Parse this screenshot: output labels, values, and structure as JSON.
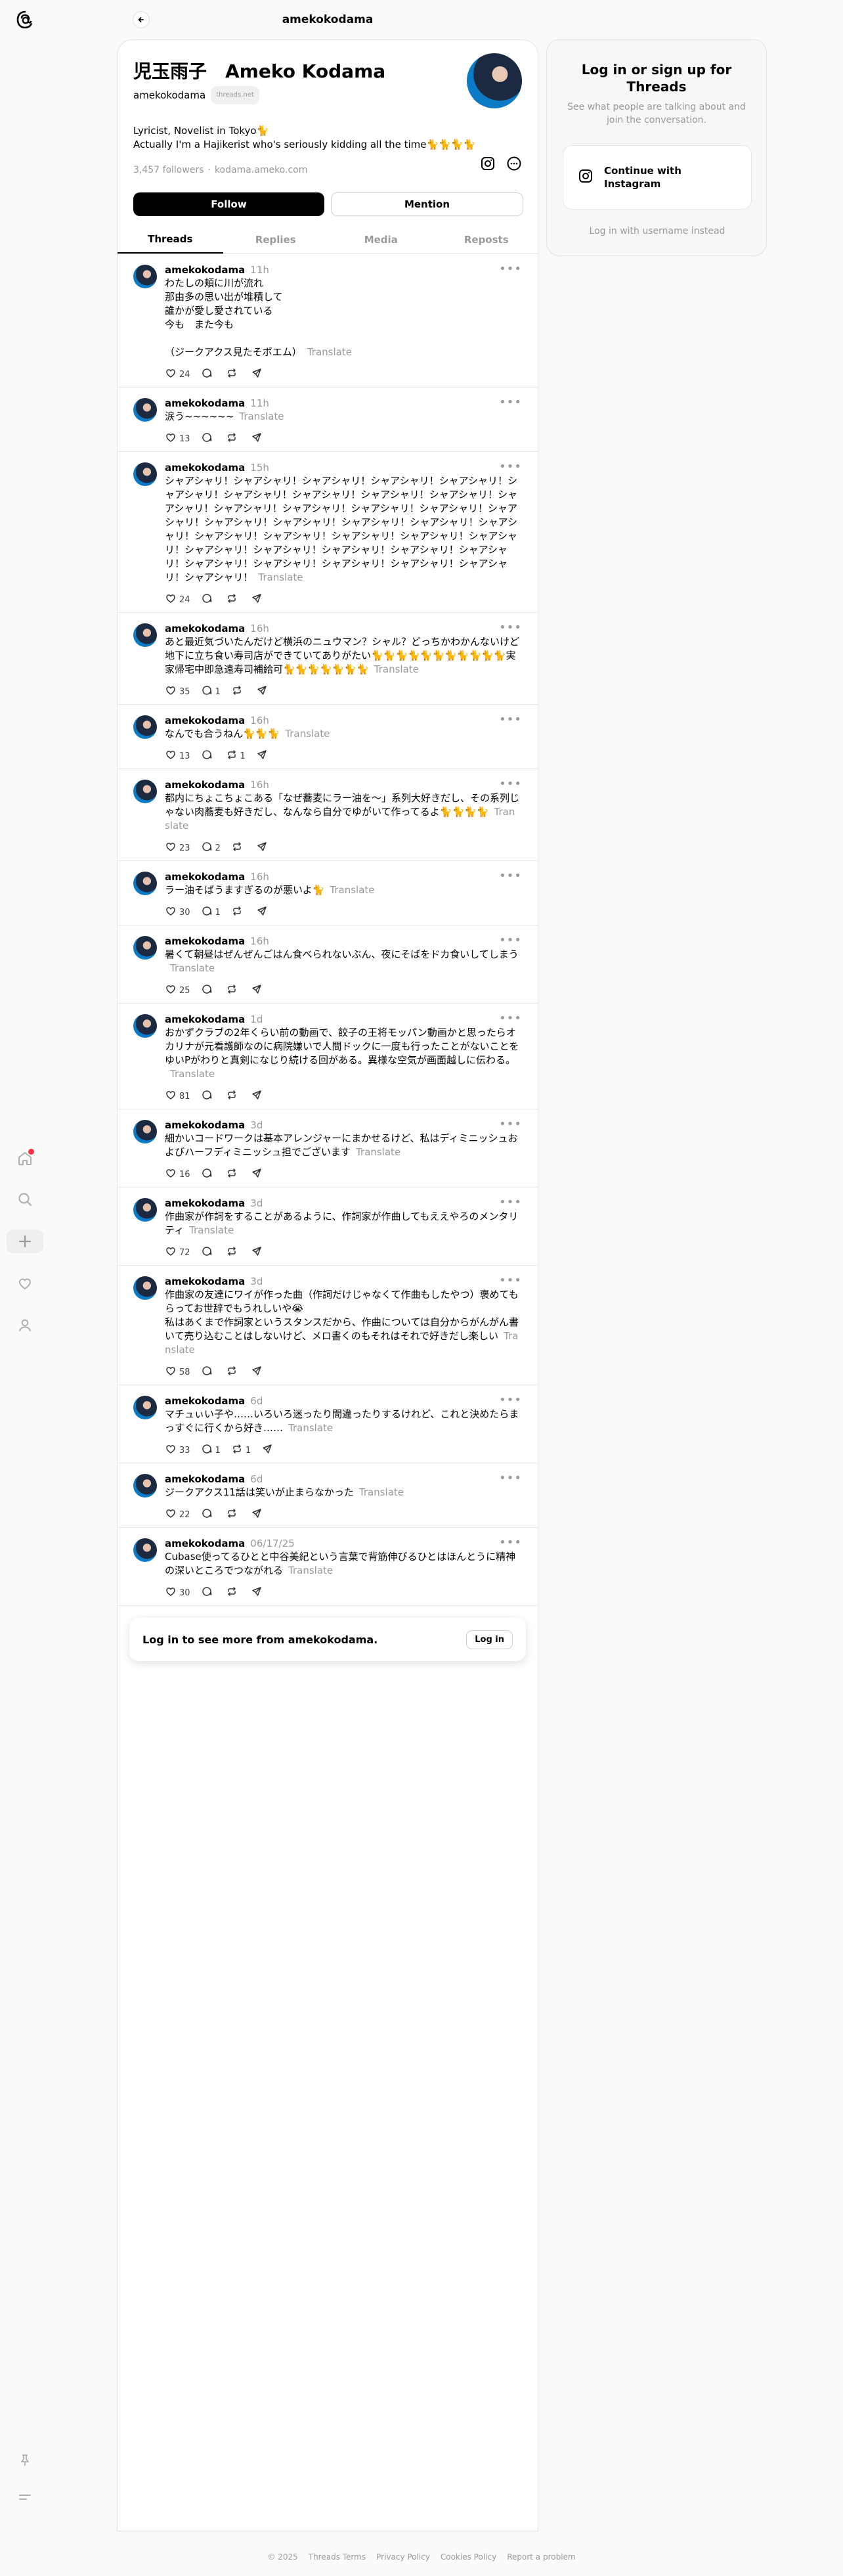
{
  "topbar": {
    "title": "amekokodama"
  },
  "profile": {
    "name": "児玉雨子　Ameko Kodama",
    "username": "amekokodama",
    "badge": "threads.net",
    "bio": "Lyricist, Novelist in Tokyo🐈\nActually I'm a Hajikerist who's seriously kidding all the time🐈🐈🐈🐈",
    "followers": "3,457 followers",
    "link": "kodama.ameko.com",
    "follow_label": "Follow",
    "mention_label": "Mention"
  },
  "tabs": [
    {
      "label": "Threads",
      "active": true
    },
    {
      "label": "Replies",
      "active": false
    },
    {
      "label": "Media",
      "active": false
    },
    {
      "label": "Reposts",
      "active": false
    }
  ],
  "translate_label": "Translate",
  "posts": [
    {
      "author": "amekokodama",
      "time": "11h",
      "text": "わたしの頬に川が流れ\n那由多の思い出が堆積して\n誰かが愛し愛されている\n今も　また今も\n\n（ジークアクス見たそポエム）",
      "likes": "24",
      "replies": "",
      "reposts": ""
    },
    {
      "author": "amekokodama",
      "time": "11h",
      "text": "涙う~~~~~~",
      "likes": "13",
      "replies": "",
      "reposts": ""
    },
    {
      "author": "amekokodama",
      "time": "15h",
      "text": "シャアシャリ！シャアシャリ！シャアシャリ！シャアシャリ！シャアシャリ！シャアシャリ！シャアシャリ！シャアシャリ！シャアシャリ！シャアシャリ！シャアシャリ！シャアシャリ！シャアシャリ！シャアシャリ！シャアシャリ！シャアシャリ！シャアシャリ！シャアシャリ！シャアシャリ！シャアシャリ！シャアシャリ！シャアシャリ！シャアシャリ！シャアシャリ！シャアシャリ！シャアシャリ！シャアシャリ！シャアシャリ！シャアシャリ！シャアシャリ！シャアシャリ！シャアシャリ！シャアシャリ！シャアシャリ！シャアシャリ！シャアシャリ！シャアシャリ！",
      "likes": "24",
      "replies": "",
      "reposts": ""
    },
    {
      "author": "amekokodama",
      "time": "16h",
      "text": "あと最近気づいたんだけど横浜のニュウマン？シャル？どっちかわかんないけど地下に立ち食い寿司店ができていてありがたい🐈🐈🐈🐈🐈🐈🐈🐈🐈🐈🐈実家帰宅中即急遠寿司補給可🐈🐈🐈🐈🐈🐈🐈",
      "likes": "35",
      "replies": "1",
      "reposts": ""
    },
    {
      "author": "amekokodama",
      "time": "16h",
      "text": "なんでも合うねん🐈🐈🐈",
      "likes": "13",
      "replies": "",
      "reposts": "1"
    },
    {
      "author": "amekokodama",
      "time": "16h",
      "text": "都内にちょこちょこある「なぜ蕎麦にラー油を〜」系列大好きだし、その系列じゃない肉蕎麦も好きだし、なんなら自分でゆがいて作ってるよ🐈🐈🐈🐈",
      "likes": "23",
      "replies": "2",
      "reposts": ""
    },
    {
      "author": "amekokodama",
      "time": "16h",
      "text": "ラー油そばうますぎるのが悪いよ🐈",
      "likes": "30",
      "replies": "1",
      "reposts": ""
    },
    {
      "author": "amekokodama",
      "time": "16h",
      "text": "暑くて朝昼はぜんぜんごはん食べられないぶん、夜にそばをドカ食いしてしまう",
      "likes": "25",
      "replies": "",
      "reposts": ""
    },
    {
      "author": "amekokodama",
      "time": "1d",
      "text": "おかずクラブの2年くらい前の動画で、餃子の王将モッパン動画かと思ったらオカリナが元看護師なのに病院嫌いで人間ドックに一度も行ったことがないことをゆいPがわりと真剣になじり続ける回がある。異様な空気が画面越しに伝わる。",
      "likes": "81",
      "replies": "",
      "reposts": ""
    },
    {
      "author": "amekokodama",
      "time": "3d",
      "text": "細かいコードワークは基本アレンジャーにまかせるけど、私はディミニッシュおよびハーフディミニッシュ担でございます",
      "likes": "16",
      "replies": "",
      "reposts": ""
    },
    {
      "author": "amekokodama",
      "time": "3d",
      "text": "作曲家が作詞をすることがあるように、作詞家が作曲してもええやろのメンタリティ",
      "likes": "72",
      "replies": "",
      "reposts": ""
    },
    {
      "author": "amekokodama",
      "time": "3d",
      "text": "作曲家の友達にワイが作った曲（作詞だけじゃなくて作曲もしたやつ）褒めてもらってお世辞でもうれしいや😭\n私はあくまで作詞家というスタンスだから、作曲については自分からがんがん書いて売り込むことはしないけど、メロ書くのもそれはそれで好きだし楽しい",
      "likes": "58",
      "replies": "",
      "reposts": ""
    },
    {
      "author": "amekokodama",
      "time": "6d",
      "text": "マチュぃい子や……いろいろ迷ったり間違ったりするけれど、これと決めたらまっすぐに行くから好き……",
      "likes": "33",
      "replies": "1",
      "reposts": "1"
    },
    {
      "author": "amekokodama",
      "time": "6d",
      "text": "ジークアクス11話は笑いが止まらなかった",
      "likes": "22",
      "replies": "",
      "reposts": ""
    },
    {
      "author": "amekokodama",
      "time": "06/17/25",
      "text": "Cubase使ってるひとと中谷美紀という言葉で背筋伸びるひとはほんとうに精神の深いところでつながれる",
      "likes": "30",
      "replies": "",
      "reposts": ""
    }
  ],
  "login_prompt": {
    "text": "Log in to see more from amekokodama.",
    "button": "Log in"
  },
  "sidecard": {
    "title": "Log in or sign up for Threads",
    "subtitle": "See what people are talking about and join the conversation.",
    "ig_button": "Continue with Instagram",
    "username_link": "Log in with username instead"
  },
  "footer": [
    "© 2025",
    "Threads Terms",
    "Privacy Policy",
    "Cookies Policy",
    "Report a problem"
  ],
  "colors": {
    "accent": "#000000",
    "muted": "#999999",
    "notification": "#ff3040",
    "avatar": "#0b7ac7"
  }
}
